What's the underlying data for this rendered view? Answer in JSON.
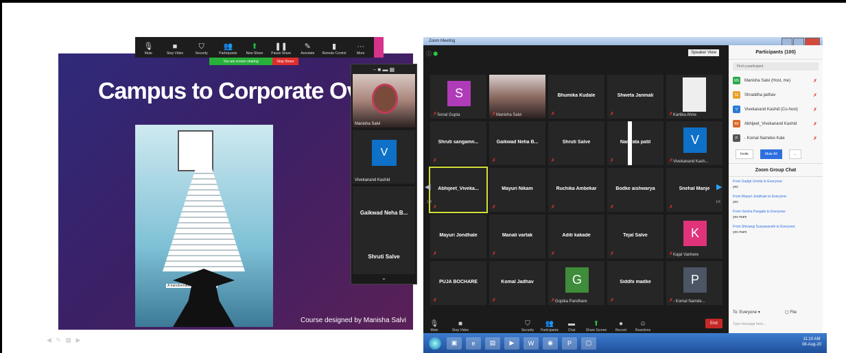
{
  "left_screenshot": {
    "slide": {
      "title": "Campus to Corporate Overvi",
      "tagline": "A transformation waked through",
      "footer": "Course designed by Manisha Salvi"
    },
    "toolbar": [
      {
        "label": "Mute",
        "icon": "mic-icon"
      },
      {
        "label": "Stop Video",
        "icon": "video-icon"
      },
      {
        "label": "Security",
        "icon": "shield-icon"
      },
      {
        "label": "Participants",
        "icon": "participants-icon",
        "badge": "55"
      },
      {
        "label": "New Share",
        "icon": "share-icon"
      },
      {
        "label": "Pause Share",
        "icon": "pause-icon"
      },
      {
        "label": "Annotate",
        "icon": "pen-icon"
      },
      {
        "label": "Remote Control",
        "icon": "mouse-icon"
      },
      {
        "label": "More",
        "icon": "more-icon"
      }
    ],
    "share_banner": {
      "status": "You are screen sharing",
      "stop": "Stop Share"
    },
    "gallery": [
      {
        "name": "Manisha Salvi"
      },
      {
        "name": "Vivekanand Kashid",
        "initial": "V"
      },
      {
        "name": "Gaikwad Neha B..."
      },
      {
        "name": "Shruti Salve"
      }
    ]
  },
  "zoom": {
    "window_title": "Zoom Meeting",
    "speaker_view": "Speaker View",
    "page_left": "1/4",
    "page_right": "1/4",
    "tiles": [
      {
        "name": "Sonal Gupta",
        "avatar": "S",
        "color": "#b03bb8"
      },
      {
        "name": "Manisha Salvi"
      },
      {
        "name": "Bhumika Kudale"
      },
      {
        "name": "Shweta Janmali"
      },
      {
        "name": "Kartika Ahire",
        "prefix": "# "
      },
      {
        "name": "Shruti sangamn..."
      },
      {
        "name": "Gaikwad Neha B..."
      },
      {
        "name": "Shruti Salve"
      },
      {
        "name": "Namrata patil"
      },
      {
        "name": "Vivekanand Kash...",
        "avatar": "V",
        "color": "#0e71c7"
      },
      {
        "name": "Abhijeet_Viveka..."
      },
      {
        "name": "Mayuri Nikam"
      },
      {
        "name": "Ruchika Ambekar"
      },
      {
        "name": "Bodke aishwarya"
      },
      {
        "name": "Snehal Manje"
      },
      {
        "name": "Mayuri Jondhale"
      },
      {
        "name": "Manali vartak"
      },
      {
        "name": "Aditi kakade"
      },
      {
        "name": "Tejal Salve"
      },
      {
        "name": "Kajal Vanhere",
        "avatar": "K",
        "color": "#e0337a"
      },
      {
        "name": "PUJA BOCHARE"
      },
      {
        "name": "Komal Jadhav"
      },
      {
        "name": "Gopika Pandhare",
        "avatar": "G",
        "color": "#3f8c3a"
      },
      {
        "name": "Siddhi madke"
      },
      {
        "name": "- Komal Namde...",
        "avatar": "P",
        "color": "#4b5563"
      }
    ],
    "bottom_bar": [
      {
        "label": "Mute"
      },
      {
        "label": "Stop Video"
      },
      {
        "label": "Security"
      },
      {
        "label": "Participants",
        "badge": "100"
      },
      {
        "label": "Chat"
      },
      {
        "label": "Share Screen"
      },
      {
        "label": "Record"
      },
      {
        "label": "Reactions"
      }
    ],
    "end_label": "End",
    "participants_panel": {
      "title": "Participants (100)",
      "search_placeholder": "Find a participant",
      "rows": [
        {
          "initials": "MS",
          "name": "Manisha Salvi (Host, me)",
          "color": "#2aa84a"
        },
        {
          "initials": "SJ",
          "name": "Shraddha jadhav",
          "color": "#e8a02a"
        },
        {
          "initials": "V",
          "name": "Vivekanand Kashid (Co-host)",
          "color": "#2b7bd6"
        },
        {
          "initials": "AK",
          "name": "Abhijeet_Vivekanand Kashid",
          "color": "#d9662a"
        },
        {
          "initials": "P",
          "name": "- Komal Namdeo Kale",
          "color": "#555"
        }
      ],
      "invite": "Invite",
      "mute_all": "Mute All",
      "more": "..."
    },
    "chat": {
      "title": "Zoom Group Chat",
      "messages": [
        {
          "from": "From Sadgir Urmila to Everyone:",
          "text": "yes"
        },
        {
          "from": "From Mayuri Jondhale to Everyone:",
          "text": "yes"
        },
        {
          "from": "From Varsha Pangale to Everyone:",
          "text": "yes mam"
        },
        {
          "from": "From Shivangi Suryawanshi to Everyone:",
          "text": "yes mam"
        }
      ],
      "to_label": "To:",
      "to_value": "Everyone",
      "file": "File",
      "placeholder": "Type message here..."
    },
    "taskbar": {
      "time": "11:10 AM",
      "date": "08-Aug-20"
    }
  }
}
